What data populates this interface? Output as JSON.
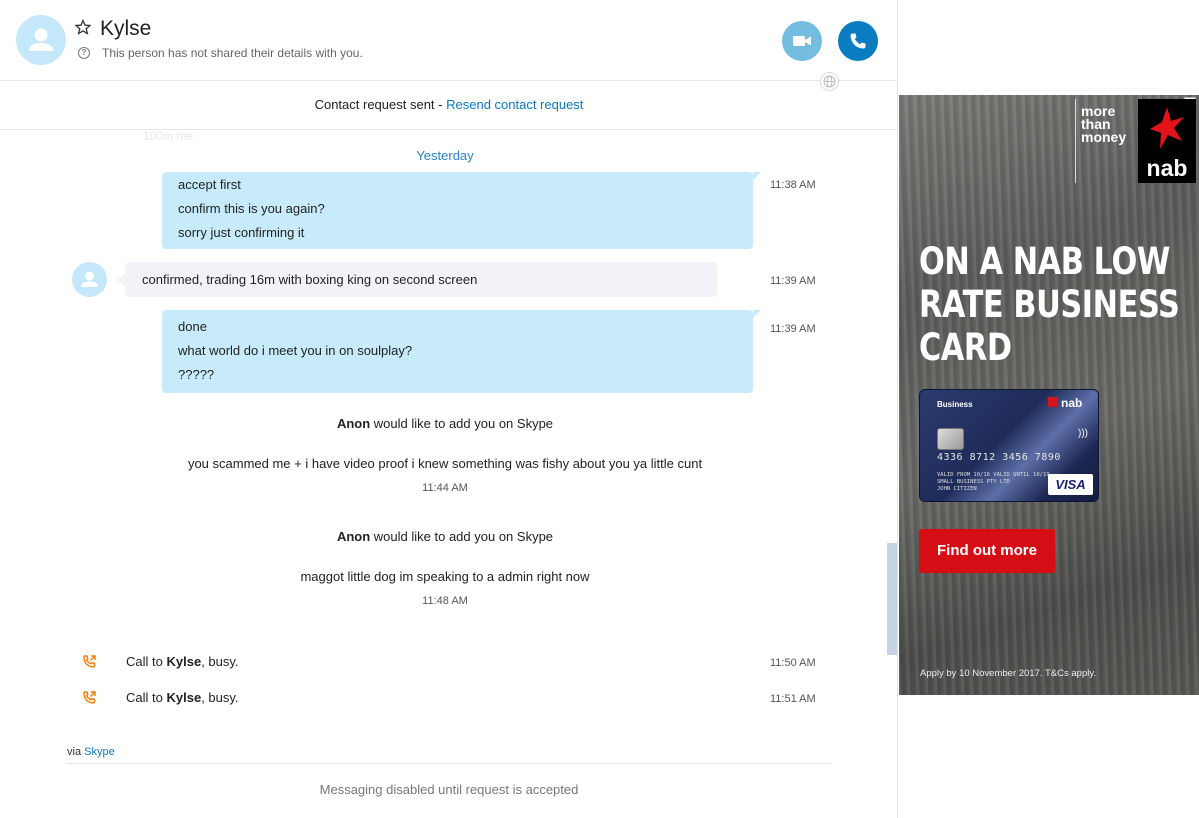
{
  "header": {
    "contact_name": "Kylse",
    "subtitle": "This person has not shared their details with you.",
    "icons": [
      "avatar-icon",
      "star-icon",
      "info-icon",
      "video-call-icon",
      "phone-icon",
      "globe-icon"
    ]
  },
  "request_bar": {
    "text": "Contact request sent -",
    "link": "Resend contact request"
  },
  "conversation": {
    "ghost_text": "100m me",
    "date_separator": "Yesterday",
    "messages": [
      {
        "direction": "outgoing",
        "lines": [
          "accept first",
          "confirm this is you again?",
          "sorry just confirming it"
        ],
        "time": "11:38 AM"
      },
      {
        "direction": "incoming",
        "text": "confirmed, trading 16m with boxing king on second screen",
        "time": "11:39 AM"
      },
      {
        "direction": "outgoing",
        "lines": [
          "done",
          "what world do i meet you in on soulplay?",
          "?????"
        ],
        "time": "11:39 AM"
      }
    ],
    "system_events": [
      {
        "name": "Anon",
        "action": "would like to add you on Skype",
        "message": "you scammed me + i have video proof i knew something was fishy about you ya little cunt",
        "time": "11:44 AM"
      },
      {
        "name": "Anon",
        "action": "would like to add you on Skype",
        "message": "maggot little dog im speaking to a admin right now",
        "time": "11:48 AM"
      }
    ],
    "calls": [
      {
        "prefix": "Call to",
        "name": "Kylse",
        "suffix": ", busy.",
        "time": "11:50 AM"
      },
      {
        "prefix": "Call to",
        "name": "Kylse",
        "suffix": ", busy.",
        "time": "11:51 AM"
      }
    ]
  },
  "footer": {
    "via": "via",
    "via_link": "Skype",
    "disabled_message": "Messaging disabled until request is accepted"
  },
  "ad": {
    "tagline": [
      "more",
      "than",
      "money"
    ],
    "brand": "nab",
    "headline": [
      "ON A NAB LOW",
      "RATE BUSINESS",
      "CARD"
    ],
    "card_label": "Business",
    "card_brand": "nab",
    "card_number": "4336 8712 3456 7890",
    "card_valid_from": "VALID FROM 10/16",
    "card_valid_until": "VALID UNTIL 10/19",
    "card_company": "SMALL BUSINESS PTY LTD",
    "card_holder": "JOHN CITIZEN",
    "card_network": "VISA",
    "cta": "Find out more",
    "fine_print": "Apply by 10 November 2017. T&Cs apply.",
    "corner_badge": "i▷",
    "colors": {
      "brand_red": "#d40e14",
      "bubble_out": "#c7ebfb",
      "link_blue": "#0a78be"
    }
  }
}
